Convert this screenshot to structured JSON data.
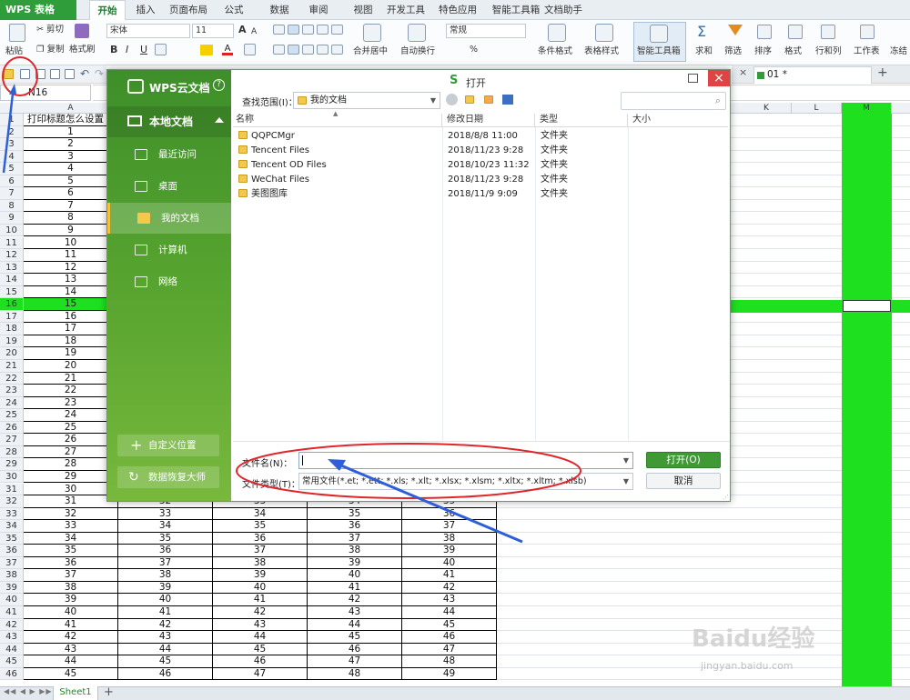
{
  "app": {
    "logo": "WPS 表格",
    "menu_tabs": [
      "开始",
      "插入",
      "页面布局",
      "公式",
      "数据",
      "审阅",
      "视图",
      "开发工具",
      "特色应用",
      "智能工具箱",
      "文档助手"
    ],
    "active_tab": "开始"
  },
  "ribbon": {
    "paste": "粘贴",
    "cut": "剪切",
    "copy": "复制",
    "format_painter": "格式刷",
    "font_name": "宋体",
    "font_size": "11",
    "bold": "B",
    "italic": "I",
    "underline": "U",
    "grow_font": "A",
    "shrink_font": "A",
    "merge_center": "合并居中",
    "wrap_text": "自动换行",
    "number_format": "常规",
    "percent": "%",
    "conditional_format": "条件格式",
    "table_style": "表格样式",
    "smart_toolbox": "智能工具箱",
    "sum": "求和",
    "filter": "筛选",
    "sort": "排序",
    "format": "格式",
    "row_col": "行和列",
    "worksheet": "工作表",
    "freeze": "冻结"
  },
  "doc_tab": {
    "label": "01 *",
    "add": "+",
    "close": "×"
  },
  "name_box": "N16",
  "sheet": {
    "col_headers": [
      "A",
      "K",
      "L",
      "M"
    ],
    "rows": [
      {
        "n": "1",
        "a": "打印标题怎么设置",
        "b": "",
        "c": "",
        "d": "",
        "e": ""
      },
      {
        "n": "2",
        "a": "1",
        "b": "",
        "c": "",
        "d": "",
        "e": ""
      },
      {
        "n": "3",
        "a": "2",
        "b": "",
        "c": "",
        "d": "",
        "e": ""
      },
      {
        "n": "4",
        "a": "3",
        "b": "",
        "c": "",
        "d": "",
        "e": ""
      },
      {
        "n": "5",
        "a": "4",
        "b": "",
        "c": "",
        "d": "",
        "e": ""
      },
      {
        "n": "6",
        "a": "5",
        "b": "",
        "c": "",
        "d": "",
        "e": ""
      },
      {
        "n": "7",
        "a": "6",
        "b": "",
        "c": "",
        "d": "",
        "e": ""
      },
      {
        "n": "8",
        "a": "7",
        "b": "",
        "c": "",
        "d": "",
        "e": ""
      },
      {
        "n": "9",
        "a": "8",
        "b": "",
        "c": "",
        "d": "",
        "e": ""
      },
      {
        "n": "10",
        "a": "9",
        "b": "",
        "c": "",
        "d": "",
        "e": ""
      },
      {
        "n": "11",
        "a": "10",
        "b": "",
        "c": "",
        "d": "",
        "e": ""
      },
      {
        "n": "12",
        "a": "11",
        "b": "",
        "c": "",
        "d": "",
        "e": ""
      },
      {
        "n": "13",
        "a": "12",
        "b": "",
        "c": "",
        "d": "",
        "e": ""
      },
      {
        "n": "14",
        "a": "13",
        "b": "",
        "c": "",
        "d": "",
        "e": ""
      },
      {
        "n": "15",
        "a": "14",
        "b": "",
        "c": "",
        "d": "",
        "e": ""
      },
      {
        "n": "16",
        "a": "15",
        "b": "",
        "c": "",
        "d": "",
        "e": ""
      },
      {
        "n": "17",
        "a": "16",
        "b": "",
        "c": "",
        "d": "",
        "e": ""
      },
      {
        "n": "18",
        "a": "17",
        "b": "",
        "c": "",
        "d": "",
        "e": ""
      },
      {
        "n": "19",
        "a": "18",
        "b": "",
        "c": "",
        "d": "",
        "e": ""
      },
      {
        "n": "20",
        "a": "19",
        "b": "",
        "c": "",
        "d": "",
        "e": ""
      },
      {
        "n": "21",
        "a": "20",
        "b": "",
        "c": "",
        "d": "",
        "e": ""
      },
      {
        "n": "22",
        "a": "21",
        "b": "",
        "c": "",
        "d": "",
        "e": ""
      },
      {
        "n": "23",
        "a": "22",
        "b": "",
        "c": "",
        "d": "",
        "e": ""
      },
      {
        "n": "24",
        "a": "23",
        "b": "",
        "c": "",
        "d": "",
        "e": ""
      },
      {
        "n": "25",
        "a": "24",
        "b": "",
        "c": "",
        "d": "",
        "e": ""
      },
      {
        "n": "26",
        "a": "25",
        "b": "",
        "c": "",
        "d": "",
        "e": ""
      },
      {
        "n": "27",
        "a": "26",
        "b": "",
        "c": "",
        "d": "",
        "e": ""
      },
      {
        "n": "28",
        "a": "27",
        "b": "",
        "c": "",
        "d": "",
        "e": ""
      },
      {
        "n": "29",
        "a": "28",
        "b": "",
        "c": "",
        "d": "",
        "e": ""
      },
      {
        "n": "30",
        "a": "29",
        "b": "",
        "c": "",
        "d": "",
        "e": ""
      },
      {
        "n": "31",
        "a": "30",
        "b": "",
        "c": "",
        "d": "",
        "e": ""
      },
      {
        "n": "32",
        "a": "31",
        "b": "32",
        "c": "33",
        "d": "34",
        "e": "35"
      },
      {
        "n": "33",
        "a": "32",
        "b": "33",
        "c": "34",
        "d": "35",
        "e": "36"
      },
      {
        "n": "34",
        "a": "33",
        "b": "34",
        "c": "35",
        "d": "36",
        "e": "37"
      },
      {
        "n": "35",
        "a": "34",
        "b": "35",
        "c": "36",
        "d": "37",
        "e": "38"
      },
      {
        "n": "36",
        "a": "35",
        "b": "36",
        "c": "37",
        "d": "38",
        "e": "39"
      },
      {
        "n": "37",
        "a": "36",
        "b": "37",
        "c": "38",
        "d": "39",
        "e": "40"
      },
      {
        "n": "38",
        "a": "37",
        "b": "38",
        "c": "39",
        "d": "40",
        "e": "41"
      },
      {
        "n": "39",
        "a": "38",
        "b": "39",
        "c": "40",
        "d": "41",
        "e": "42"
      },
      {
        "n": "40",
        "a": "39",
        "b": "40",
        "c": "41",
        "d": "42",
        "e": "43"
      },
      {
        "n": "41",
        "a": "40",
        "b": "41",
        "c": "42",
        "d": "43",
        "e": "44"
      },
      {
        "n": "42",
        "a": "41",
        "b": "42",
        "c": "43",
        "d": "44",
        "e": "45"
      },
      {
        "n": "43",
        "a": "42",
        "b": "43",
        "c": "44",
        "d": "45",
        "e": "46"
      },
      {
        "n": "44",
        "a": "43",
        "b": "44",
        "c": "45",
        "d": "46",
        "e": "47"
      },
      {
        "n": "45",
        "a": "44",
        "b": "45",
        "c": "46",
        "d": "47",
        "e": "48"
      },
      {
        "n": "46",
        "a": "45",
        "b": "46",
        "c": "47",
        "d": "48",
        "e": "49"
      }
    ]
  },
  "sheet_tab": "Sheet1",
  "sheet_add": "+",
  "dialog": {
    "title": "打开",
    "sidebar": {
      "brand": "WPS云文档",
      "section": "本地文档",
      "items": [
        "最近访问",
        "桌面",
        "我的文档",
        "计算机",
        "网络"
      ],
      "active": "我的文档",
      "custom_location": "自定义位置",
      "recovery": "数据恢复大师"
    },
    "lookin_label": "查找范围(I)：",
    "lookin_value": "我的文档",
    "columns": [
      "名称",
      "修改日期",
      "类型",
      "大小"
    ],
    "files": [
      {
        "name": "QQPCMgr",
        "date": "2018/8/8 11:00",
        "type": "文件夹",
        "size": ""
      },
      {
        "name": "Tencent Files",
        "date": "2018/11/23 9:28",
        "type": "文件夹",
        "size": ""
      },
      {
        "name": "Tencent OD Files",
        "date": "2018/10/23 11:32",
        "type": "文件夹",
        "size": ""
      },
      {
        "name": "WeChat Files",
        "date": "2018/11/23 9:28",
        "type": "文件夹",
        "size": ""
      },
      {
        "name": "美图图库",
        "date": "2018/11/9 9:09",
        "type": "文件夹",
        "size": ""
      }
    ],
    "filename_label": "文件名(N)：",
    "filename_value": "",
    "filetype_label": "文件类型(T)：",
    "filetype_value": "常用文件(*.et; *.ett; *.xls; *.xlt; *.xlsx; *.xlsm; *.xltx; *.xltm; *.xlsb)",
    "open_button": "打开(O)",
    "cancel_button": "取消"
  },
  "watermark": {
    "logo": "Baidu经验",
    "url": "jingyan.baidu.com"
  },
  "colors": {
    "accent": "#2f9d3a",
    "highlight_green": "#1ee01e",
    "annotation_red": "#e0262a",
    "annotation_blue": "#2e5fd6"
  }
}
